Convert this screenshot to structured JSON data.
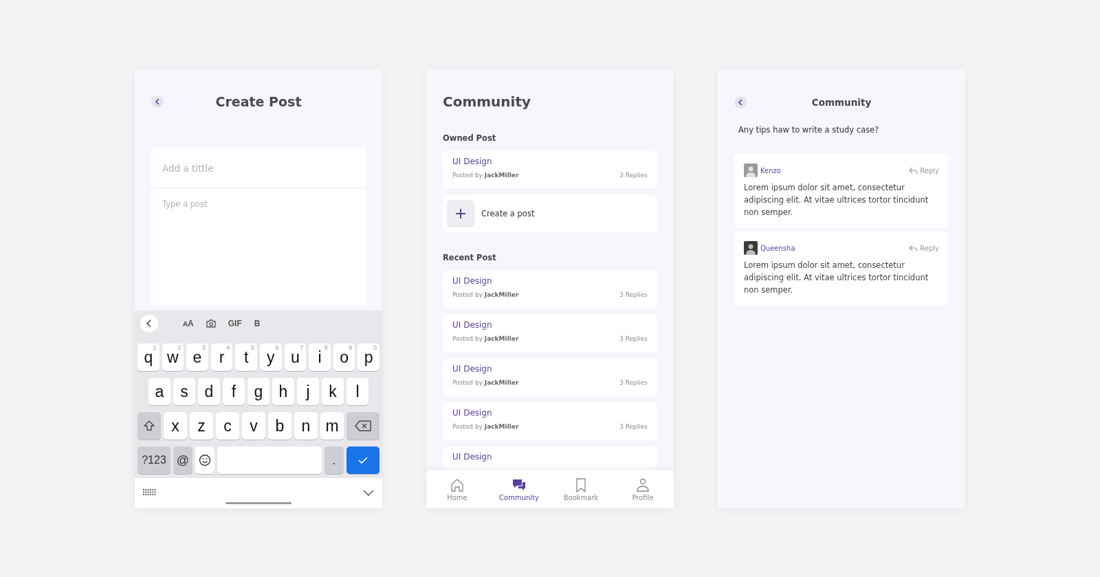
{
  "create_post": {
    "title": "Create Post",
    "title_field": {
      "placeholder": "Add a tittle"
    },
    "post_field": {
      "placeholder": "Type a post"
    },
    "keyboard": {
      "toolbar": [
        {
          "kind": "back"
        },
        {
          "kind": "text",
          "label": "ᴀA"
        },
        {
          "kind": "camera"
        },
        {
          "kind": "text",
          "label": "GIF"
        },
        {
          "kind": "text",
          "label": "B"
        }
      ],
      "rows": [
        {
          "keys": [
            {
              "kind": "letter",
              "label": "q",
              "hint": "1"
            },
            {
              "kind": "letter",
              "label": "w",
              "hint": "2"
            },
            {
              "kind": "letter",
              "label": "e",
              "hint": "3"
            },
            {
              "kind": "letter",
              "label": "r",
              "hint": "4"
            },
            {
              "kind": "letter",
              "label": "t",
              "hint": "5"
            },
            {
              "kind": "letter",
              "label": "y",
              "hint": "6"
            },
            {
              "kind": "letter",
              "label": "u",
              "hint": "7"
            },
            {
              "kind": "letter",
              "label": "i",
              "hint": "8"
            },
            {
              "kind": "letter",
              "label": "o",
              "hint": "9"
            },
            {
              "kind": "letter",
              "label": "p",
              "hint": "0"
            }
          ]
        },
        {
          "keys": [
            {
              "kind": "letter",
              "label": "a"
            },
            {
              "kind": "letter",
              "label": "s"
            },
            {
              "kind": "letter",
              "label": "d"
            },
            {
              "kind": "letter",
              "label": "f"
            },
            {
              "kind": "letter",
              "label": "g"
            },
            {
              "kind": "letter",
              "label": "h"
            },
            {
              "kind": "letter",
              "label": "j"
            },
            {
              "kind": "letter",
              "label": "k"
            },
            {
              "kind": "letter",
              "label": "l"
            }
          ]
        },
        {
          "keys": [
            {
              "kind": "shift"
            },
            {
              "kind": "letter",
              "label": "x"
            },
            {
              "kind": "letter",
              "label": "z"
            },
            {
              "kind": "letter",
              "label": "c"
            },
            {
              "kind": "letter",
              "label": "v"
            },
            {
              "kind": "letter",
              "label": "b"
            },
            {
              "kind": "letter",
              "label": "n"
            },
            {
              "kind": "letter",
              "label": "m"
            },
            {
              "kind": "backspace"
            }
          ]
        },
        {
          "keys": [
            {
              "kind": "mod",
              "label": "?123"
            },
            {
              "kind": "mod",
              "label": "@"
            },
            {
              "kind": "emoji"
            },
            {
              "kind": "space"
            },
            {
              "kind": "mod",
              "label": "."
            },
            {
              "kind": "enter"
            }
          ]
        }
      ]
    }
  },
  "community": {
    "title": "Community",
    "owned": {
      "heading": "Owned Post",
      "posts": [
        {
          "title": "UI Design",
          "posted_by": "Posted by **JackMiller**",
          "replies": "3 Replies"
        }
      ],
      "create": {
        "label": "Create a post"
      }
    },
    "recent": {
      "heading": "Recent Post",
      "posts": [
        {
          "title": "UI Design",
          "posted_by": "Posted by **JackMiller**",
          "replies": "3 Replies"
        },
        {
          "title": "UI Design",
          "posted_by": "Posted by **JackMiller**",
          "replies": "3 Replies"
        },
        {
          "title": "UI Design",
          "posted_by": "Posted by **JackMiller**",
          "replies": "3 Replies"
        },
        {
          "title": "UI Design",
          "posted_by": "Posted by **JackMiller**",
          "replies": "3 Replies"
        },
        {
          "title": "UI Design"
        }
      ]
    },
    "nav": [
      {
        "label": "Home",
        "kind": "home",
        "selected": false
      },
      {
        "label": "Community",
        "kind": "chat",
        "selected": true
      },
      {
        "label": "Bookmark",
        "kind": "bookmark",
        "selected": false
      },
      {
        "label": "Profile",
        "kind": "person",
        "selected": false
      }
    ]
  },
  "thread": {
    "title": "Community",
    "question": "Any tips haw to write a study case?",
    "comments": [
      {
        "author": "Kenzo",
        "reply": "Reply",
        "body": "Lorem ipsum dolor sit amet, consectetur adipiscing elit. At vitae ultrices tortor tincidunt non semper."
      },
      {
        "author": "Queensha",
        "reply": "Reply",
        "body": "Lorem ipsum dolor sit amet, consectetur adipiscing elit. At vitae ultrices tortor tincidunt non semper."
      }
    ]
  }
}
